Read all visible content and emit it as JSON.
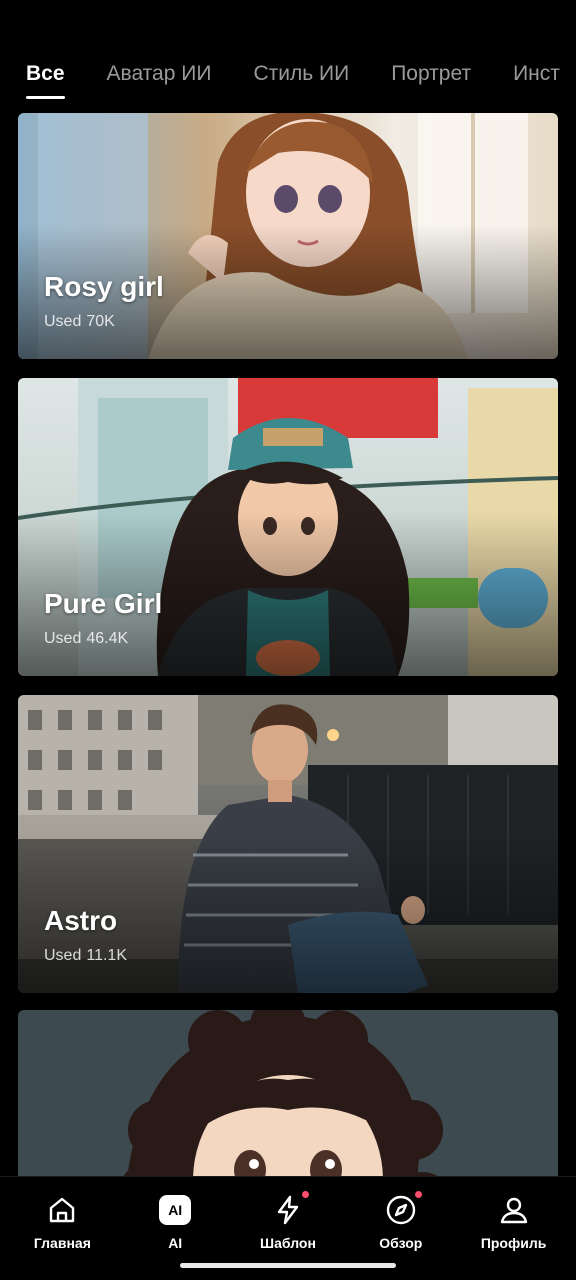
{
  "tabs": [
    {
      "label": "Все",
      "active": true
    },
    {
      "label": "Аватар ИИ",
      "active": false
    },
    {
      "label": "Стиль ИИ",
      "active": false
    },
    {
      "label": "Портрет",
      "active": false
    },
    {
      "label": "Инст",
      "active": false
    }
  ],
  "used_label": "Used",
  "cards": [
    {
      "title": "Rosy girl",
      "count": "70K"
    },
    {
      "title": "Pure Girl",
      "count": "46.4K"
    },
    {
      "title": "Astro",
      "count": "11.1K"
    }
  ],
  "nav": [
    {
      "label": "Главная",
      "icon": "home-icon"
    },
    {
      "label": "AI",
      "icon": "ai-icon",
      "badge_text": "AI"
    },
    {
      "label": "Шаблон",
      "icon": "lightning-icon",
      "dot": true
    },
    {
      "label": "Обзор",
      "icon": "compass-icon",
      "dot": true
    },
    {
      "label": "Профиль",
      "icon": "profile-icon"
    }
  ],
  "colors": {
    "background": "#000000",
    "accent_dot": "#ff4d6d",
    "inactive_tab": "#9a9a9a"
  }
}
